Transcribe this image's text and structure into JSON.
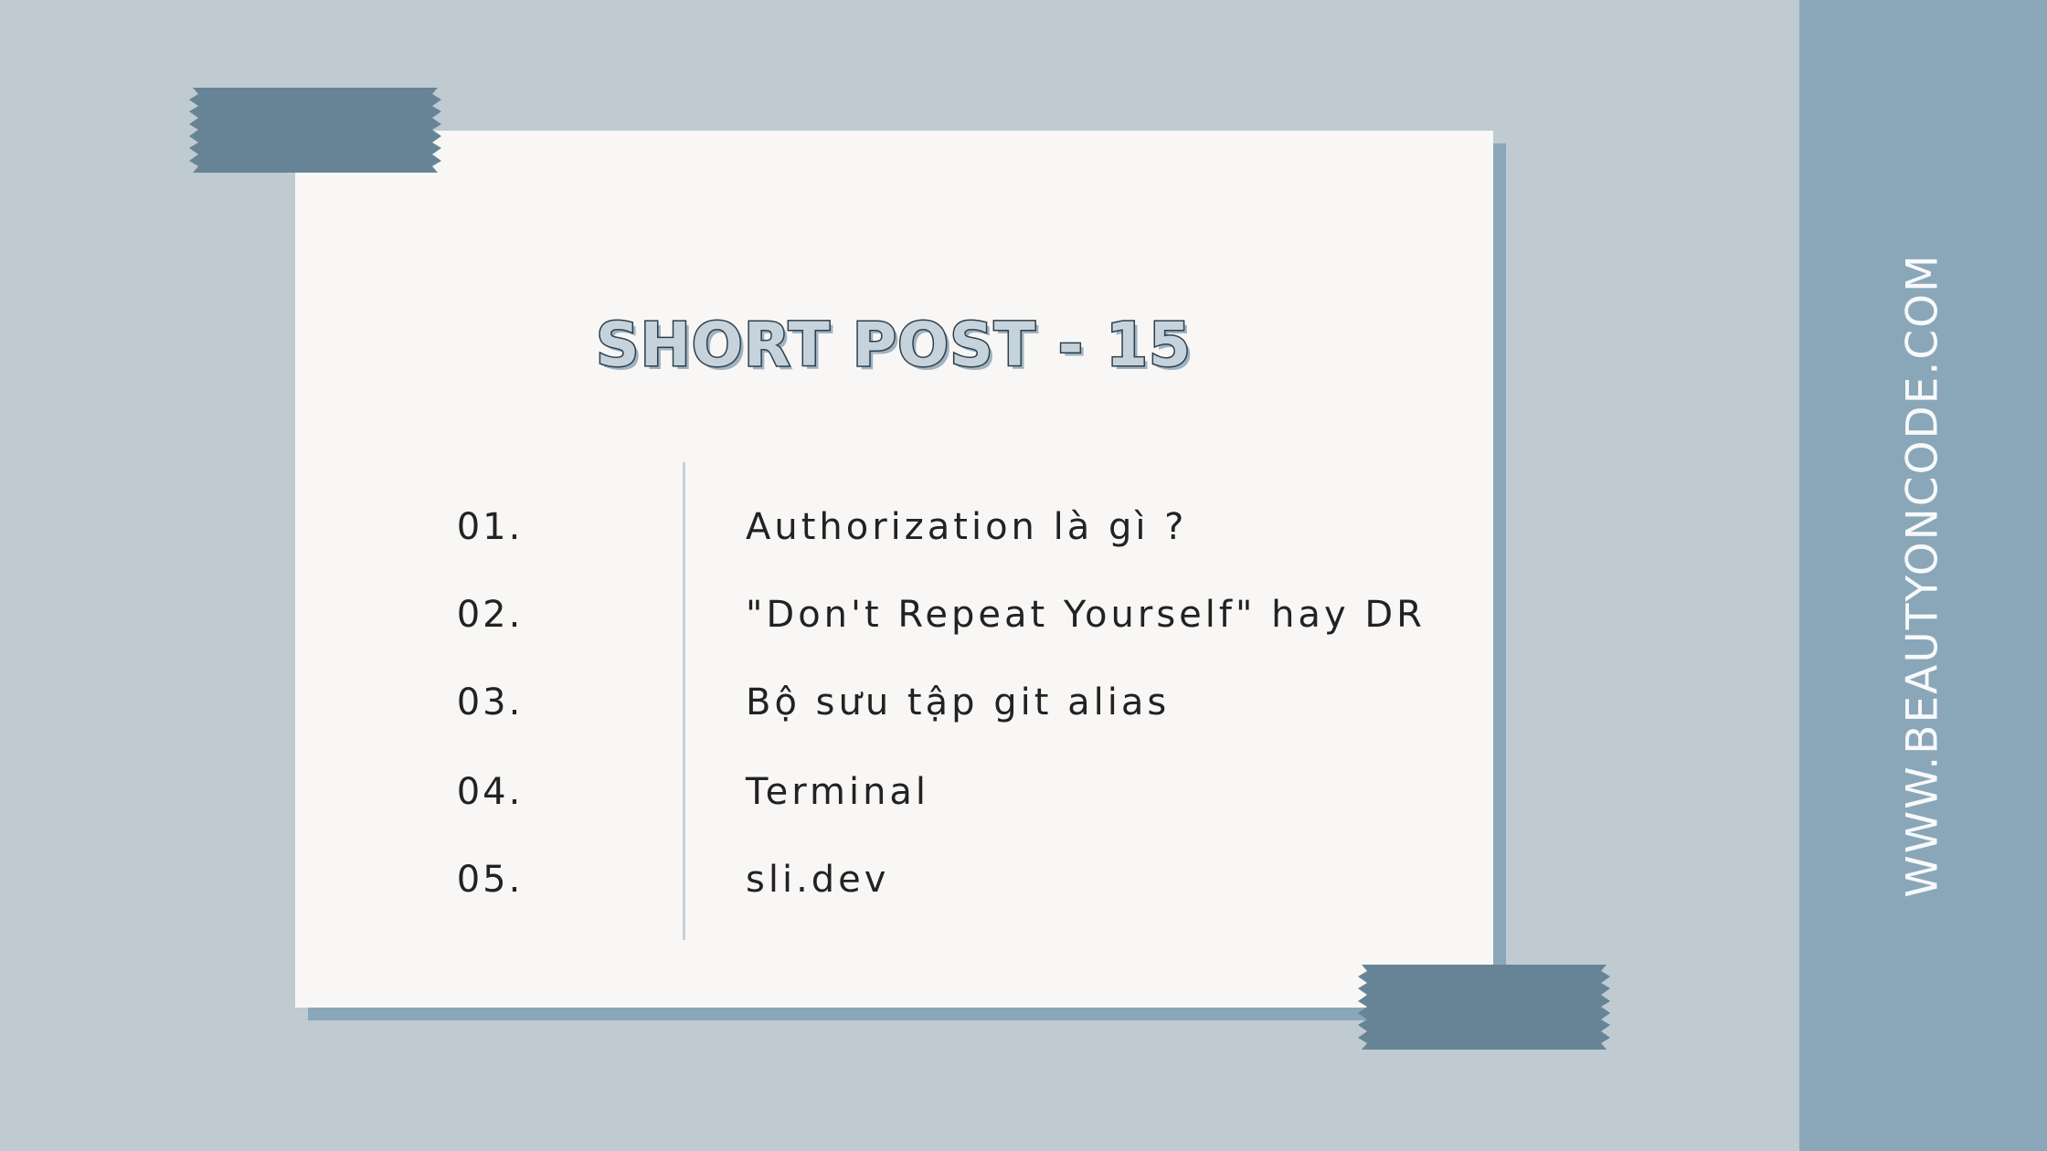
{
  "colors": {
    "background": "#bfcad1",
    "side_band": "#89a7b9",
    "card": "#f8f7f6",
    "card_shadow": "#89a7b9",
    "tape": "#668496",
    "text": "#222222",
    "title_fill": "#c7d3dc",
    "title_outline": "#2d3f4a"
  },
  "title": "SHORT POST - 15",
  "website": "WWW.BEAUTYONCODE.COM",
  "items": [
    {
      "number": "01.",
      "label": "Authorization là gì ?"
    },
    {
      "number": "02.",
      "label": "\"Don't Repeat Yourself\" hay DR"
    },
    {
      "number": "03.",
      "label": "Bộ sưu tập git alias"
    },
    {
      "number": "04.",
      "label": "Terminal"
    },
    {
      "number": "05.",
      "label": "sli.dev"
    }
  ]
}
